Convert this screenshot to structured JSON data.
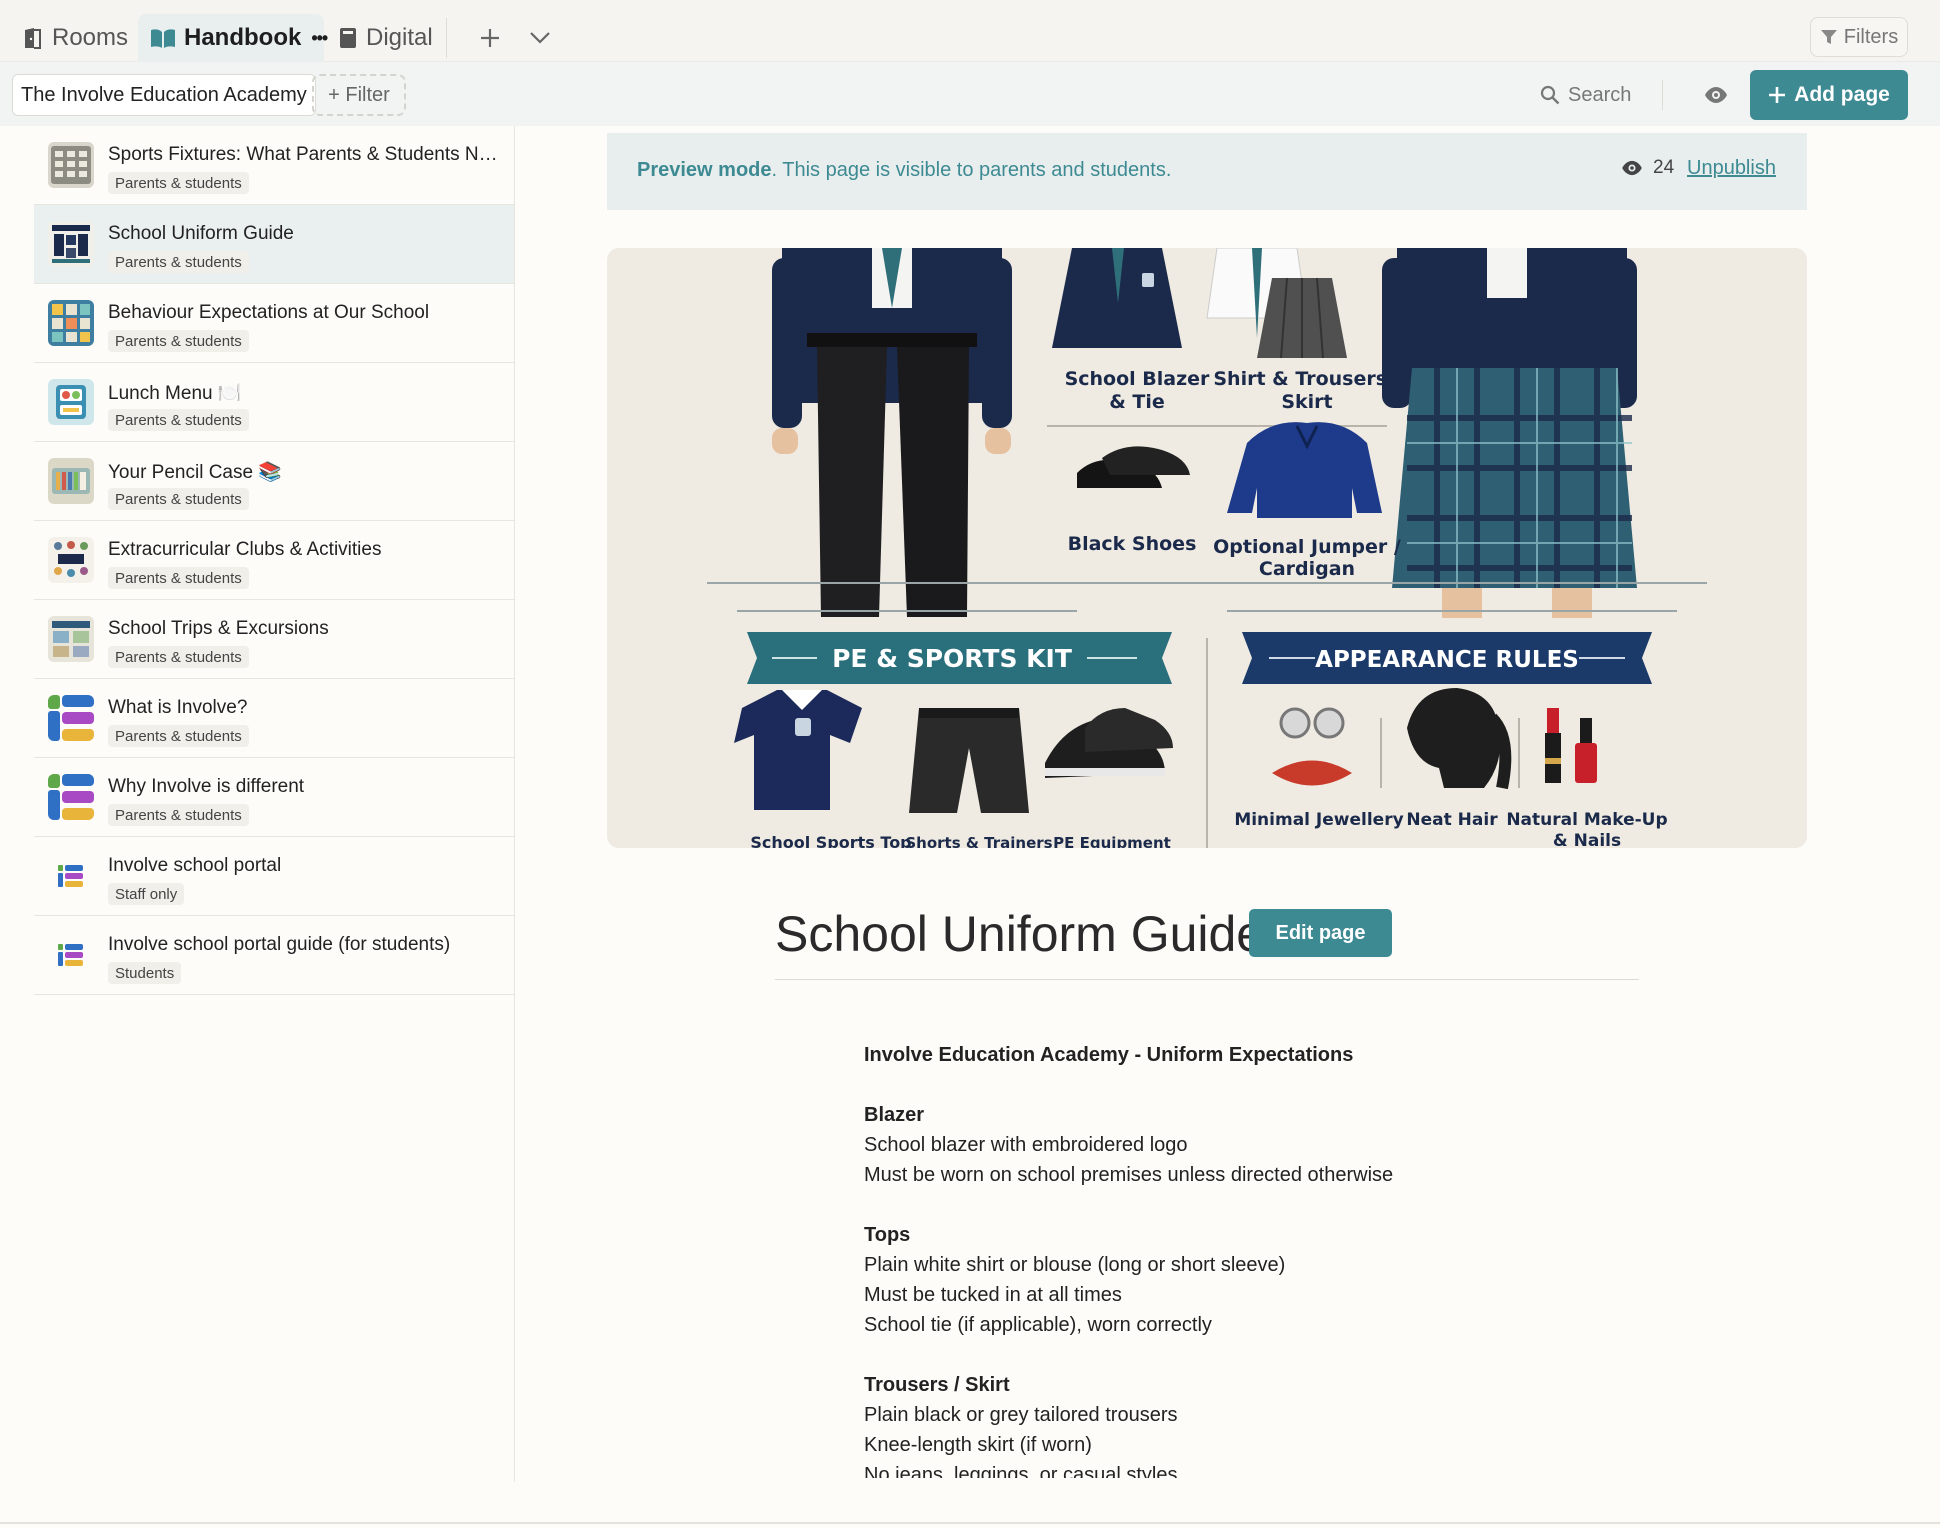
{
  "tabs": [
    {
      "label": "Rooms",
      "icon": "rooms-icon",
      "active": false
    },
    {
      "label": "Handbook",
      "icon": "book-open-icon",
      "active": true
    },
    {
      "label": "Digital",
      "icon": "book-icon",
      "active": false
    }
  ],
  "tab_more": "•••",
  "filters_label": "Filters",
  "toolbar": {
    "academy": "The Involve Education Academy",
    "filter_label": "+ Filter",
    "search_label": "Search",
    "add_page_label": "Add page"
  },
  "sidebar": {
    "items": [
      {
        "title": "Sports Fixtures: What Parents & Students Nee…",
        "badge": "Parents & students"
      },
      {
        "title": "School Uniform Guide",
        "badge": "Parents & students",
        "selected": true
      },
      {
        "title": "Behaviour Expectations at Our School",
        "badge": "Parents & students"
      },
      {
        "title": "Lunch Menu 🍽️",
        "badge": "Parents & students"
      },
      {
        "title": "Your Pencil Case 📚",
        "badge": "Parents & students"
      },
      {
        "title": "Extracurricular Clubs & Activities",
        "badge": "Parents & students"
      },
      {
        "title": "School Trips & Excursions",
        "badge": "Parents & students"
      },
      {
        "title": "What is Involve?",
        "badge": "Parents & students"
      },
      {
        "title": "Why Involve is different",
        "badge": "Parents & students"
      },
      {
        "title": "Involve school portal",
        "badge": "Staff only"
      },
      {
        "title": "Involve school portal guide (for students)",
        "badge": "Students"
      }
    ]
  },
  "preview": {
    "mode_bold": "Preview mode",
    "mode_text": ". This page is visible to parents and students.",
    "views": "24",
    "unpublish": "Unpublish"
  },
  "hero": {
    "labels": {
      "blazer": "School Blazer",
      "blazer2": "& Tie",
      "shirt": "Shirt & Trousers /",
      "shirt2": "Skirt",
      "shoes": "Black Shoes",
      "jumper": "Optional Jumper /",
      "jumper2": "Cardigan",
      "pe_banner": "PE & SPORTS KIT",
      "appearance_banner": "APPEARANCE RULES",
      "sports_top": "School Sports Top",
      "shorts": "Shorts & Trainers",
      "pe_equipment": "PE Equipment",
      "jewellery": "Minimal Jewellery",
      "hair": "Neat Hair",
      "makeup": "Natural Make-Up",
      "makeup2": "& Nails"
    }
  },
  "page": {
    "title": "School Uniform Guide",
    "edit_label": "Edit page",
    "heading": "Involve Education Academy - Uniform Expectations",
    "sections": [
      {
        "h": "Blazer",
        "lines": [
          "School blazer with embroidered logo",
          "Must be worn on school premises unless directed otherwise"
        ]
      },
      {
        "h": "Tops",
        "lines": [
          "Plain white shirt or blouse (long or short sleeve)",
          "Must be tucked in at all times",
          "School tie (if applicable), worn correctly"
        ]
      },
      {
        "h": "Trousers / Skirt",
        "lines": [
          "Plain black or grey tailored trousers",
          "Knee-length skirt (if worn)",
          "No jeans, leggings, or casual styles"
        ]
      }
    ]
  },
  "colors": {
    "accent": "#3d8a93",
    "navy": "#1b2a4a",
    "banner_bg": "#e8eeee"
  }
}
